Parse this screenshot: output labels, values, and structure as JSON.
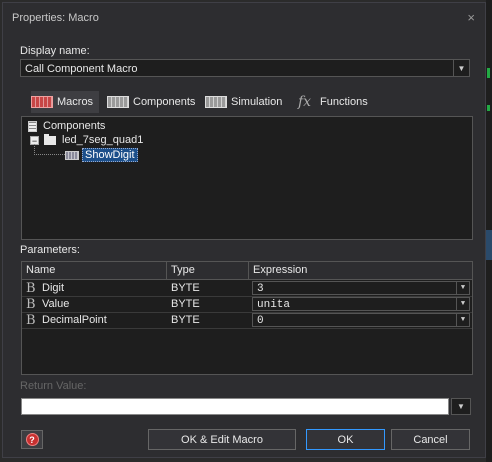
{
  "window": {
    "title": "Properties: Macro",
    "close_glyph": "×"
  },
  "display_name": {
    "label": "Display name:",
    "value": "Call Component Macro"
  },
  "tabs": [
    {
      "label": "Macros",
      "icon": "macros-icon",
      "active": true
    },
    {
      "label": "Components",
      "icon": "components-icon",
      "active": false
    },
    {
      "label": "Simulation",
      "icon": "simulation-icon",
      "active": false
    },
    {
      "label": "Functions",
      "icon": "fx-icon",
      "active": false
    }
  ],
  "tree": {
    "root": "Components",
    "component": "led_7seg_quad1",
    "macro": "ShowDigit"
  },
  "parameters": {
    "label": "Parameters:",
    "columns": [
      "Name",
      "Type",
      "Expression"
    ],
    "rows": [
      {
        "name": "Digit",
        "type": "BYTE",
        "expression": "3"
      },
      {
        "name": "Value",
        "type": "BYTE",
        "expression": "unita"
      },
      {
        "name": "DecimalPoint",
        "type": "BYTE",
        "expression": "0"
      }
    ]
  },
  "return_value": {
    "label": "Return Value:",
    "value": ""
  },
  "buttons": {
    "help": "?",
    "ok_edit": "OK & Edit Macro",
    "ok": "OK",
    "cancel": "Cancel"
  },
  "colors": {
    "accent": "#3399ff",
    "selection": "#1c4f8a",
    "macros_tab": "#c84646"
  }
}
